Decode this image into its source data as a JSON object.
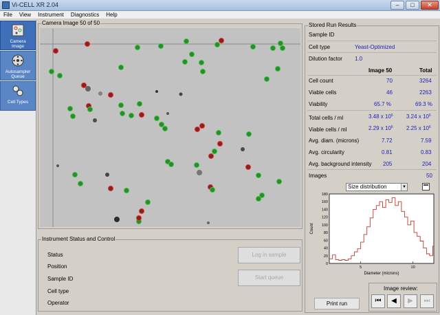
{
  "window": {
    "title": "Vi-CELL XR 2.04",
    "minimize": "–",
    "maximize": "□",
    "close": "✕"
  },
  "menu": [
    "File",
    "View",
    "Instrument",
    "Diagnostics",
    "Help"
  ],
  "sidebar": [
    {
      "label1": "Camera",
      "label2": "Image",
      "icon": "camera-image-icon"
    },
    {
      "label1": "Autosampler",
      "label2": "Queue",
      "icon": "autosampler-icon"
    },
    {
      "label1": "Cell Types",
      "label2": "",
      "icon": "cell-types-icon"
    }
  ],
  "camera": {
    "title": "Camera Image 50 of 50"
  },
  "instrument": {
    "title": "Instrument Status and Control",
    "rows": [
      "Status",
      "Position",
      "Sample ID",
      "Cell type",
      "Operator"
    ],
    "login_label": "Log in sample",
    "start_label": "Start queue"
  },
  "results": {
    "title": "Stored Run Results",
    "sample_id_label": "Sample ID",
    "cell_type_label": "Cell type",
    "cell_type_value": "Yeast-Optimized",
    "dilution_label": "Dilution factor",
    "dilution_value": "1.0",
    "col_image": "Image 50",
    "col_total": "Total",
    "cell_count": {
      "label": "Cell count",
      "image": "70",
      "total": "3264"
    },
    "viable_cells": {
      "label": "Viable cells",
      "image": "46",
      "total": "2263"
    },
    "viability": {
      "label": "Viability",
      "image": "65.7 %",
      "total": "69.3 %"
    },
    "total_ml": {
      "label": "Total cells / ml",
      "image": "3.48 x 10",
      "image_exp": "6",
      "total": "3.24 x 10",
      "total_exp": "6"
    },
    "viable_ml": {
      "label": "Viable cells / ml",
      "image": "2.29 x 10",
      "image_exp": "6",
      "total": "2.25 x 10",
      "total_exp": "6"
    },
    "diam": {
      "label": "Avg. diam. (microns)",
      "image": "7.72",
      "total": "7.59"
    },
    "circ": {
      "label": "Avg. circularity",
      "image": "0.81",
      "total": "0.83"
    },
    "bg": {
      "label": "Avg. background intensity",
      "image": "205",
      "total": "204"
    },
    "images": {
      "label": "Images",
      "total": "50"
    }
  },
  "dist_select": {
    "value": "Size distribution"
  },
  "print_label": "Print run",
  "review_title": "Image review:",
  "review_buttons": {
    "first": "⏮",
    "prev": "◀",
    "next": "▶",
    "last": "⏭"
  },
  "chart_data": {
    "type": "line",
    "title": "",
    "xlabel": "Diameter (microns)",
    "ylabel": "Count",
    "xlim": [
      2,
      12
    ],
    "ylim": [
      0,
      180
    ],
    "x_ticks": [
      "5",
      "10"
    ],
    "y_ticks": [
      "0",
      "20",
      "40",
      "60",
      "80",
      "100",
      "120",
      "140",
      "160",
      "180"
    ],
    "series": [
      {
        "color": "#c0392b",
        "x": [
          2.0,
          2.3,
          2.6,
          2.9,
          3.2,
          3.5,
          3.8,
          4.1,
          4.4,
          4.7,
          5.0,
          5.3,
          5.6,
          5.9,
          6.2,
          6.5,
          6.8,
          7.1,
          7.4,
          7.7,
          8.0,
          8.3,
          8.6,
          8.9,
          9.2,
          9.5,
          9.8,
          10.1,
          10.4,
          10.7,
          11.0,
          11.3,
          11.6,
          11.9
        ],
        "y": [
          12,
          22,
          10,
          8,
          10,
          8,
          12,
          20,
          30,
          38,
          55,
          75,
          95,
          118,
          140,
          150,
          160,
          145,
          165,
          158,
          170,
          150,
          160,
          135,
          120,
          100,
          110,
          80,
          70,
          58,
          40,
          25,
          20,
          45
        ]
      }
    ]
  },
  "cells": [
    [
      "r",
      23,
      33
    ],
    [
      "r",
      69,
      23
    ],
    [
      "g",
      142,
      28
    ],
    [
      "g",
      176,
      26
    ],
    [
      "g",
      213,
      19
    ],
    [
      "g",
      258,
      24
    ],
    [
      "r",
      264,
      18
    ],
    [
      "g",
      310,
      27
    ],
    [
      "g",
      339,
      29
    ],
    [
      "g",
      350,
      22
    ],
    [
      "g",
      353,
      29
    ],
    [
      "g",
      17,
      63
    ],
    [
      "g",
      29,
      69
    ],
    [
      "r",
      64,
      83
    ],
    [
      "g",
      118,
      57
    ],
    [
      "r",
      103,
      97
    ],
    [
      "g",
      221,
      38
    ],
    [
      "g",
      211,
      49
    ],
    [
      "g",
      235,
      50
    ],
    [
      "g",
      237,
      63
    ],
    [
      "g",
      330,
      74
    ],
    [
      "g",
      346,
      59
    ],
    [
      "g",
      44,
      117
    ],
    [
      "g",
      48,
      128
    ],
    [
      "r",
      71,
      113
    ],
    [
      "g",
      73,
      118
    ],
    [
      "g",
      118,
      112
    ],
    [
      "g",
      120,
      124
    ],
    [
      "g",
      133,
      127
    ],
    [
      "g",
      145,
      110
    ],
    [
      "r",
      148,
      126
    ],
    [
      "g",
      170,
      131
    ],
    [
      "g",
      177,
      140
    ],
    [
      "g",
      182,
      146
    ],
    [
      "r",
      229,
      147
    ],
    [
      "r",
      236,
      142
    ],
    [
      "r",
      262,
      168
    ],
    [
      "g",
      260,
      152
    ],
    [
      "g",
      304,
      154
    ],
    [
      "g",
      254,
      179
    ],
    [
      "r",
      249,
      186
    ],
    [
      "r",
      303,
      202
    ],
    [
      "g",
      318,
      214
    ],
    [
      "g",
      51,
      213
    ],
    [
      "g",
      59,
      226
    ],
    [
      "r",
      103,
      233
    ],
    [
      "g",
      126,
      236
    ],
    [
      "g",
      186,
      194
    ],
    [
      "g",
      191,
      198
    ],
    [
      "g",
      228,
      199
    ],
    [
      "g",
      144,
      281
    ],
    [
      "r",
      148,
      266
    ],
    [
      "r",
      144,
      276
    ],
    [
      "g",
      157,
      253
    ],
    [
      "r",
      248,
      231
    ],
    [
      "g",
      251,
      235
    ],
    [
      "g",
      318,
      248
    ],
    [
      "g",
      323,
      243
    ],
    [
      "g",
      348,
      223
    ]
  ]
}
